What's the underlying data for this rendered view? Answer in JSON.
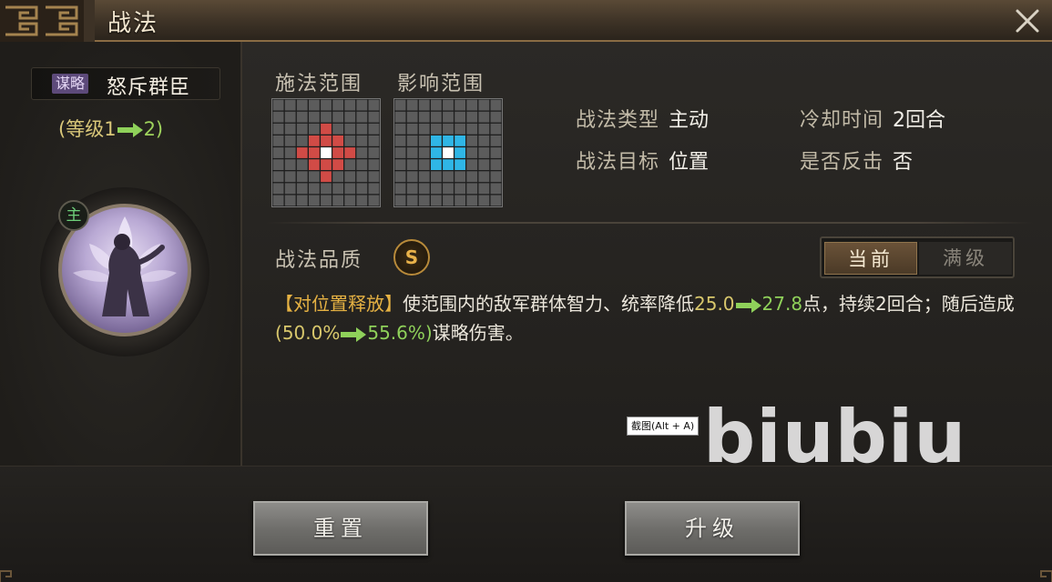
{
  "window": {
    "title": "战法",
    "colors": {
      "accent": "#8a6c44",
      "level_old": "#d8c76c",
      "level_new": "#8fd15a",
      "bracket": "#e6b243",
      "quality": "#e9b24a"
    }
  },
  "skill": {
    "tag": "谋略",
    "name": "怒斥群臣",
    "level_prefix": "(等级1",
    "level_suffix": "2)",
    "main_badge": "主"
  },
  "ranges": {
    "cast_label": "施法范围",
    "effect_label": "影响范围",
    "cast_color": "#d14b46",
    "effect_color": "#2fb6e6"
  },
  "info": {
    "type_key": "战法类型",
    "type_val": "主动",
    "cooldown_key": "冷却时间",
    "cooldown_val": "2回合",
    "target_key": "战法目标",
    "target_val": "位置",
    "counter_key": "是否反击",
    "counter_val": "否"
  },
  "quality": {
    "label": "战法品质",
    "grade": "S"
  },
  "toggle": {
    "current": "当前",
    "max": "满级"
  },
  "description": {
    "bracket": "【对位置释放】",
    "part1": "使范围内的敌军群体智力、统率降低",
    "val1_old": "25.0",
    "val1_new": "27.8",
    "part2": "点，持续2回合；随后造成",
    "paren_open": "(",
    "val2_old": "50.0%",
    "val2_new": "55.6%",
    "paren_close": ")",
    "part3": "谋略伤害。"
  },
  "buttons": {
    "reset": "重置",
    "upgrade": "升级"
  },
  "overlay": {
    "tooltip": "截图(Alt + A)",
    "watermark": "biubiu"
  }
}
